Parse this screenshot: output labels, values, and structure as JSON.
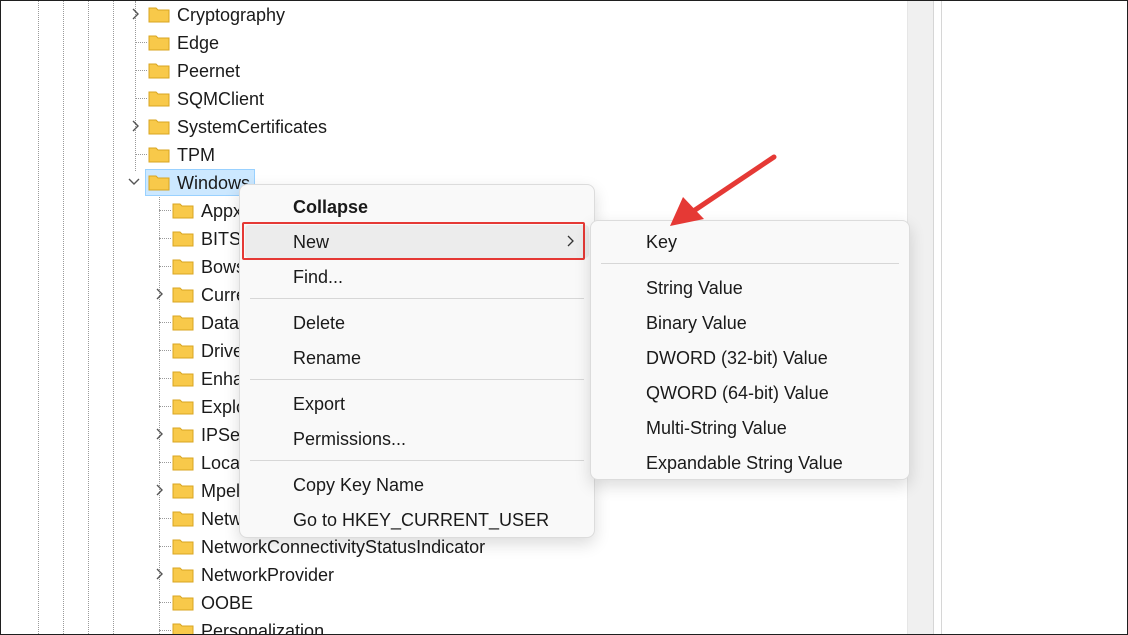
{
  "tree": {
    "nodes": [
      {
        "label": "Cryptography",
        "expander": "chevron-right"
      },
      {
        "label": "Edge",
        "expander": "none"
      },
      {
        "label": "Peernet",
        "expander": "none"
      },
      {
        "label": "SQMClient",
        "expander": "none"
      },
      {
        "label": "SystemCertificates",
        "expander": "chevron-right"
      },
      {
        "label": "TPM",
        "expander": "none"
      },
      {
        "label": "Windows",
        "expander": "chevron-down",
        "selected": true
      }
    ],
    "children": [
      {
        "label": "Appx",
        "expander": "none"
      },
      {
        "label": "BITS",
        "expander": "none"
      },
      {
        "label": "Bows",
        "expander": "none"
      },
      {
        "label": "Curre",
        "expander": "chevron-right"
      },
      {
        "label": "Data",
        "expander": "none"
      },
      {
        "label": "Drive",
        "expander": "none"
      },
      {
        "label": "Enha",
        "expander": "none"
      },
      {
        "label": "Explo",
        "expander": "none"
      },
      {
        "label": "IPSec",
        "expander": "chevron-right"
      },
      {
        "label": "Locat",
        "expander": "none"
      },
      {
        "label": "Mpel",
        "expander": "chevron-right"
      },
      {
        "label": "Netw",
        "expander": "none"
      },
      {
        "label": "NetworkConnectivityStatusIndicator",
        "expander": "none"
      },
      {
        "label": "NetworkProvider",
        "expander": "chevron-right"
      },
      {
        "label": "OOBE",
        "expander": "none"
      },
      {
        "label": "Personalization",
        "expander": "none"
      }
    ]
  },
  "context_menu": {
    "collapse": "Collapse",
    "new": "New",
    "find": "Find...",
    "delete": "Delete",
    "rename": "Rename",
    "export": "Export",
    "permissions": "Permissions...",
    "copy_key_name": "Copy Key Name",
    "go_to": "Go to HKEY_CURRENT_USER"
  },
  "new_submenu": {
    "key": "Key",
    "string_value": "String Value",
    "binary_value": "Binary Value",
    "dword_value": "DWORD (32-bit) Value",
    "qword_value": "QWORD (64-bit) Value",
    "multi_string_value": "Multi-String Value",
    "expandable_string_value": "Expandable String Value"
  },
  "colors": {
    "folder": "#f8c94a",
    "selection": "#cce8ff",
    "annotation": "#e53935"
  }
}
